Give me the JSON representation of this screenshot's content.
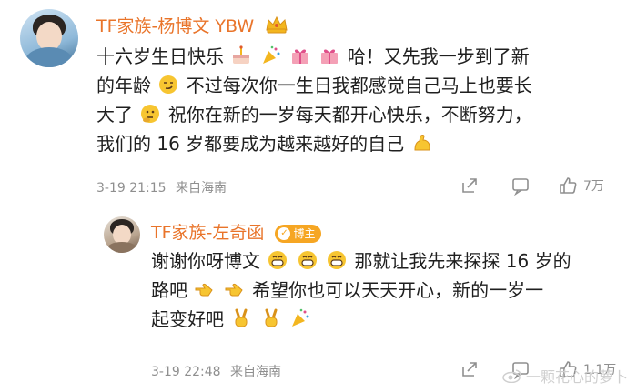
{
  "comment1": {
    "username": "TF家族-杨博文 YBW",
    "line1": "十六岁生日快乐",
    "line1_tail": "哈！又先我一步到了新",
    "line2a": "的年龄",
    "line2b": "不过每次你一生日我都感觉自己马上也要长",
    "line3a": "大了",
    "line3b": "祝你在新的一岁每天都开心快乐，不断努力，",
    "line4": "我们的 16 岁都要成为越来越好的自己",
    "time": "3-19 21:15",
    "source": "来自海南",
    "like_count": "7万"
  },
  "comment2": {
    "username": "TF家族-左奇函",
    "badge": "博主",
    "line1a": "谢谢你呀博文",
    "line1b": "那就让我先来探探 16 岁的",
    "line2a": "路吧",
    "line2b": "希望你也可以天天开心，新的一岁一",
    "line3": "起变好吧",
    "time": "3-19 22:48",
    "source": "来自海南",
    "like_count": "1.1万"
  },
  "watermark": "一颗花心的萝卜",
  "colors": {
    "username": "#e9742a",
    "meta": "#8f8f8f",
    "badge": "#f6a623"
  }
}
